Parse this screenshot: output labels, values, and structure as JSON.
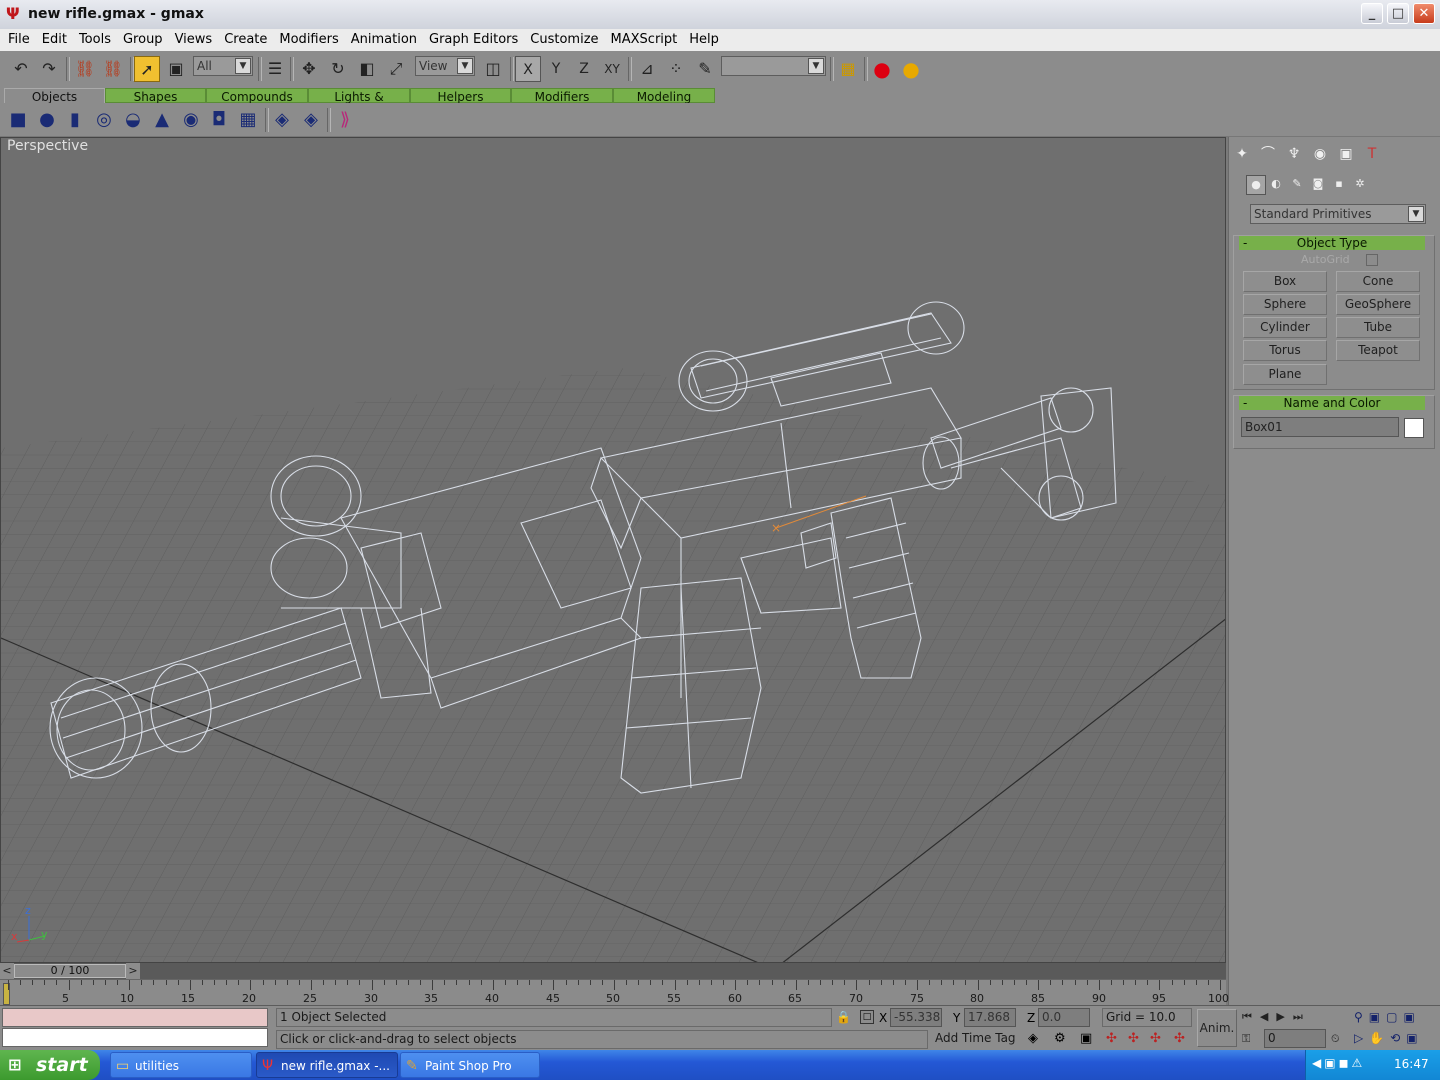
{
  "window": {
    "title": "new rifle.gmax - gmax",
    "app_icon": "gmax-icon",
    "min": "_",
    "max": "□",
    "close": "✕"
  },
  "menu": [
    "File",
    "Edit",
    "Tools",
    "Group",
    "Views",
    "Create",
    "Modifiers",
    "Animation",
    "Graph Editors",
    "Customize",
    "MAXScript",
    "Help"
  ],
  "toolbar": {
    "selection_filter": "All",
    "ref_coord": "View",
    "named_selection": "",
    "axis_x": "X",
    "axis_y": "Y",
    "axis_z": "Z",
    "axis_xy": "XY"
  },
  "tabs": [
    "Objects",
    "Shapes",
    "Compounds",
    "Lights & Cameras",
    "Helpers",
    "Modifiers",
    "Modeling"
  ],
  "active_tab": "Objects",
  "viewport": {
    "label": "Perspective",
    "axis_x": "x",
    "axis_y": "y",
    "axis_z": "z"
  },
  "command_panel": {
    "category": "Standard Primitives",
    "object_type": {
      "title": "Object Type",
      "autogrid": "AutoGrid",
      "buttons": [
        "Box",
        "Cone",
        "Sphere",
        "GeoSphere",
        "Cylinder",
        "Tube",
        "Torus",
        "Teapot",
        "Plane"
      ]
    },
    "name_color": {
      "title": "Name and Color",
      "name_value": "Box01",
      "color": "#ffffff"
    }
  },
  "timeline": {
    "slider": "0 / 100",
    "ticks": [
      "5",
      "10",
      "15",
      "20",
      "25",
      "30",
      "35",
      "40",
      "45",
      "50",
      "55",
      "60",
      "65",
      "70",
      "75",
      "80",
      "85",
      "90",
      "95",
      "100"
    ]
  },
  "status": {
    "selection": "1 Object Selected",
    "prompt": "Click or click-and-drag to select objects",
    "x_label": "X",
    "x_value": "-55.338",
    "y_label": "Y",
    "y_value": "17.868",
    "z_label": "Z",
    "z_value": "0.0",
    "grid": "Grid = 10.0",
    "add_time_tag": "Add Time Tag",
    "anim": "Anim.",
    "frame": "0"
  },
  "taskbar": {
    "start": "start",
    "tasks": [
      "utilities",
      "new rifle.gmax -...",
      "Paint Shop Pro"
    ],
    "clock": "16:47"
  },
  "colors": {
    "panel_gray": "#8c8c8c",
    "tab_green": "#77b04a",
    "viewport": "#6f6f6f",
    "wire": "#d8dde6",
    "taskbar_blue": "#2458d6"
  }
}
